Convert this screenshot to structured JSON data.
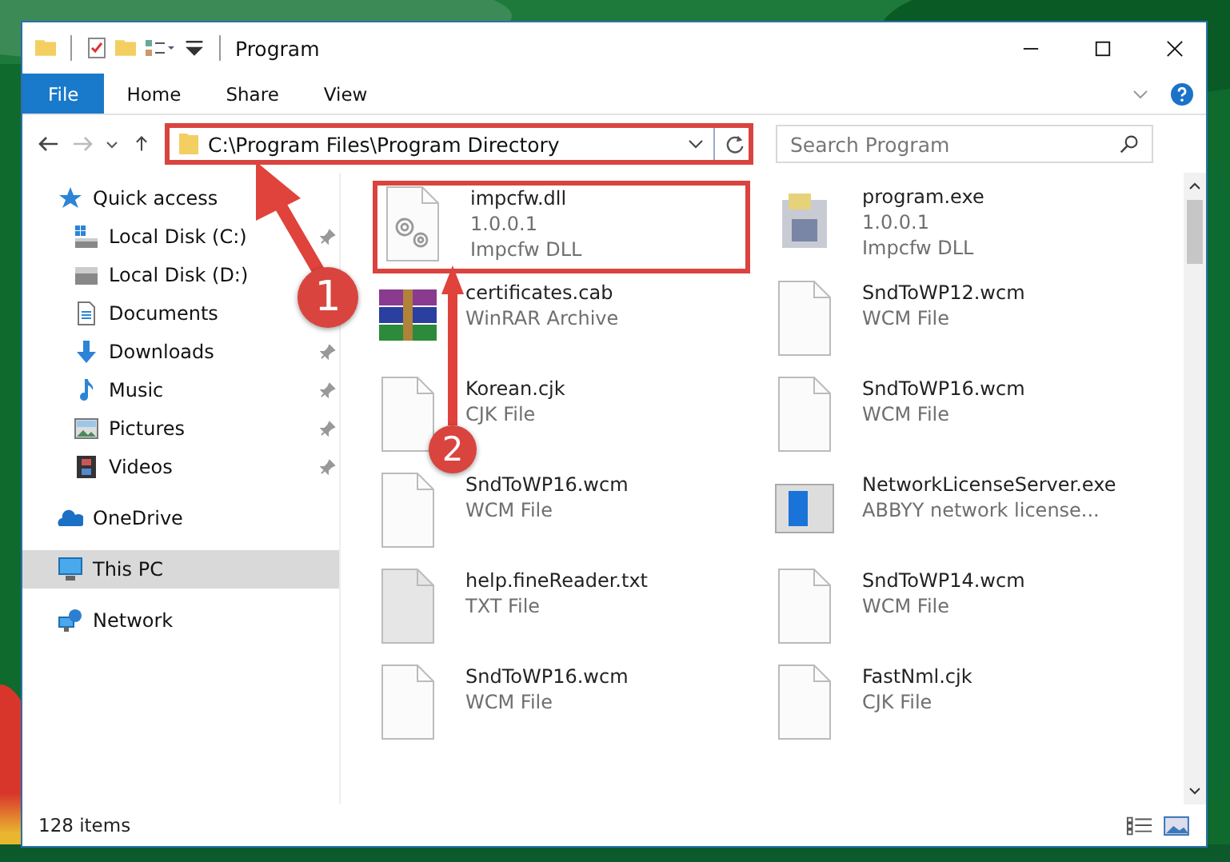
{
  "window": {
    "title": "Program"
  },
  "ribbon_tabs": [
    {
      "label": "File",
      "kind": "file"
    },
    {
      "label": "Home",
      "kind": "tab"
    },
    {
      "label": "Share",
      "kind": "tab"
    },
    {
      "label": "View",
      "kind": "tab"
    }
  ],
  "address": {
    "path": "C:\\Program Files\\Program Directory",
    "highlighted": true
  },
  "search": {
    "placeholder": "Search Program"
  },
  "sidebar": {
    "items": [
      {
        "label": "Quick access",
        "kind": "quick-access",
        "selected": false,
        "children": [
          {
            "label": "Local Disk (C:)",
            "kind": "system-drive",
            "pinned": true,
            "selected": false
          },
          {
            "label": "Local Disk (D:)",
            "kind": "drive",
            "pinned": false,
            "selected": false
          },
          {
            "label": "Documents",
            "kind": "documents",
            "pinned": false,
            "selected": false
          },
          {
            "label": "Downloads",
            "kind": "downloads",
            "pinned": true,
            "selected": false
          },
          {
            "label": "Music",
            "kind": "music",
            "pinned": true,
            "selected": false
          },
          {
            "label": "Pictures",
            "kind": "pictures",
            "pinned": true,
            "selected": false
          },
          {
            "label": "Videos",
            "kind": "videos",
            "pinned": true,
            "selected": false
          }
        ]
      },
      {
        "label": "OneDrive",
        "kind": "cloud",
        "selected": false
      },
      {
        "label": "This PC",
        "kind": "computer",
        "selected": true
      },
      {
        "label": "Network",
        "kind": "network",
        "selected": false
      }
    ]
  },
  "files": [
    {
      "name": "impcfw.dll",
      "details": [
        "1.0.0.1",
        "Impcfw DLL"
      ],
      "kind": "dll",
      "highlighted": true
    },
    {
      "name": "program.exe",
      "details": [
        "1.0.0.1",
        "Impcfw DLL"
      ],
      "kind": "exe",
      "highlighted": false
    },
    {
      "name": "certificates.cab",
      "details": [
        "WinRAR Archive"
      ],
      "kind": "archive",
      "highlighted": false
    },
    {
      "name": "SndToWP12.wcm",
      "details": [
        "WCM File"
      ],
      "kind": "blank",
      "highlighted": false
    },
    {
      "name": "Korean.cjk",
      "details": [
        "CJK File"
      ],
      "kind": "blank",
      "highlighted": false
    },
    {
      "name": "SndToWP16.wcm",
      "details": [
        "WCM File"
      ],
      "kind": "blank",
      "highlighted": false
    },
    {
      "name": "SndToWP16.wcm",
      "details": [
        "WCM File"
      ],
      "kind": "blank",
      "highlighted": false
    },
    {
      "name": "NetworkLicenseServer.exe",
      "details": [
        "ABBYY network license..."
      ],
      "kind": "window",
      "highlighted": false
    },
    {
      "name": "help.fineReader.txt",
      "details": [
        "TXT File"
      ],
      "kind": "text",
      "highlighted": false
    },
    {
      "name": "SndToWP14.wcm",
      "details": [
        "WCM File"
      ],
      "kind": "blank",
      "highlighted": false
    },
    {
      "name": "SndToWP16.wcm",
      "details": [
        "WCM File"
      ],
      "kind": "blank",
      "highlighted": false
    },
    {
      "name": "FastNml.cjk",
      "details": [
        "CJK File"
      ],
      "kind": "blank",
      "highlighted": false
    }
  ],
  "status_bar": {
    "count": "128 items"
  },
  "annotations": [
    {
      "number": "1"
    },
    {
      "number": "2"
    }
  ]
}
